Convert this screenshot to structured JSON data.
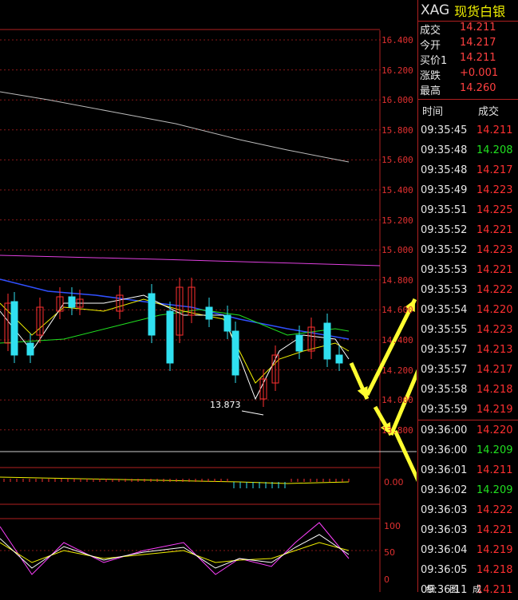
{
  "symbol": {
    "code": "XAG",
    "name": "现货白银"
  },
  "quote": [
    {
      "label": "成交",
      "value": "14.211"
    },
    {
      "label": "今开",
      "value": "14.217"
    },
    {
      "label": "买价1",
      "value": "14.211"
    },
    {
      "label": "涨跌",
      "value": "+0.001"
    },
    {
      "label": "最高",
      "value": "14.260"
    }
  ],
  "trades_header": {
    "time": "时间",
    "price": "成交"
  },
  "trades": [
    {
      "time": "09:35:45",
      "price": "14.211",
      "dir": "up"
    },
    {
      "time": "09:35:48",
      "price": "14.208",
      "dir": "down"
    },
    {
      "time": "09:35:48",
      "price": "14.217",
      "dir": "up"
    },
    {
      "time": "09:35:49",
      "price": "14.223",
      "dir": "up"
    },
    {
      "time": "09:35:51",
      "price": "14.225",
      "dir": "up"
    },
    {
      "time": "09:35:52",
      "price": "14.221",
      "dir": "up"
    },
    {
      "time": "09:35:52",
      "price": "14.223",
      "dir": "up"
    },
    {
      "time": "09:35:53",
      "price": "14.221",
      "dir": "up"
    },
    {
      "time": "09:35:53",
      "price": "14.222",
      "dir": "up"
    },
    {
      "time": "09:35:54",
      "price": "14.220",
      "dir": "up"
    },
    {
      "time": "09:35:55",
      "price": "14.223",
      "dir": "up"
    },
    {
      "time": "09:35:57",
      "price": "14.213",
      "dir": "up"
    },
    {
      "time": "09:35:57",
      "price": "14.217",
      "dir": "up"
    },
    {
      "time": "09:35:58",
      "price": "14.218",
      "dir": "up"
    },
    {
      "time": "09:35:59",
      "price": "14.219",
      "dir": "up"
    },
    {
      "time": "09:36:00",
      "price": "14.220",
      "dir": "up"
    },
    {
      "time": "09:36:00",
      "price": "14.209",
      "dir": "down"
    },
    {
      "time": "09:36:01",
      "price": "14.211",
      "dir": "up"
    },
    {
      "time": "09:36:02",
      "price": "14.209",
      "dir": "down"
    },
    {
      "time": "09:36:03",
      "price": "14.222",
      "dir": "up"
    },
    {
      "time": "09:36:03",
      "price": "14.221",
      "dir": "up"
    },
    {
      "time": "09:36:04",
      "price": "14.219",
      "dir": "up"
    },
    {
      "time": "09:36:05",
      "price": "14.218",
      "dir": "up"
    },
    {
      "time": "09:36:11",
      "price": "14.211",
      "dir": "up"
    }
  ],
  "price_axis": [
    "16.400",
    "16.200",
    "16.000",
    "15.800",
    "15.600",
    "15.400",
    "15.200",
    "15.000",
    "14.800",
    "14.600",
    "14.400",
    "14.200",
    "14.000",
    "13.800"
  ],
  "low_marker": "13.873",
  "macd_axis": "0.00",
  "kdj_axis": [
    "100",
    "50",
    "0"
  ],
  "bottom_tabs": [
    "细",
    "图",
    "成"
  ],
  "colors": {
    "up": "#ff3030",
    "down": "#20e020",
    "accent": "#f0f000",
    "grid": "#b02020"
  }
}
